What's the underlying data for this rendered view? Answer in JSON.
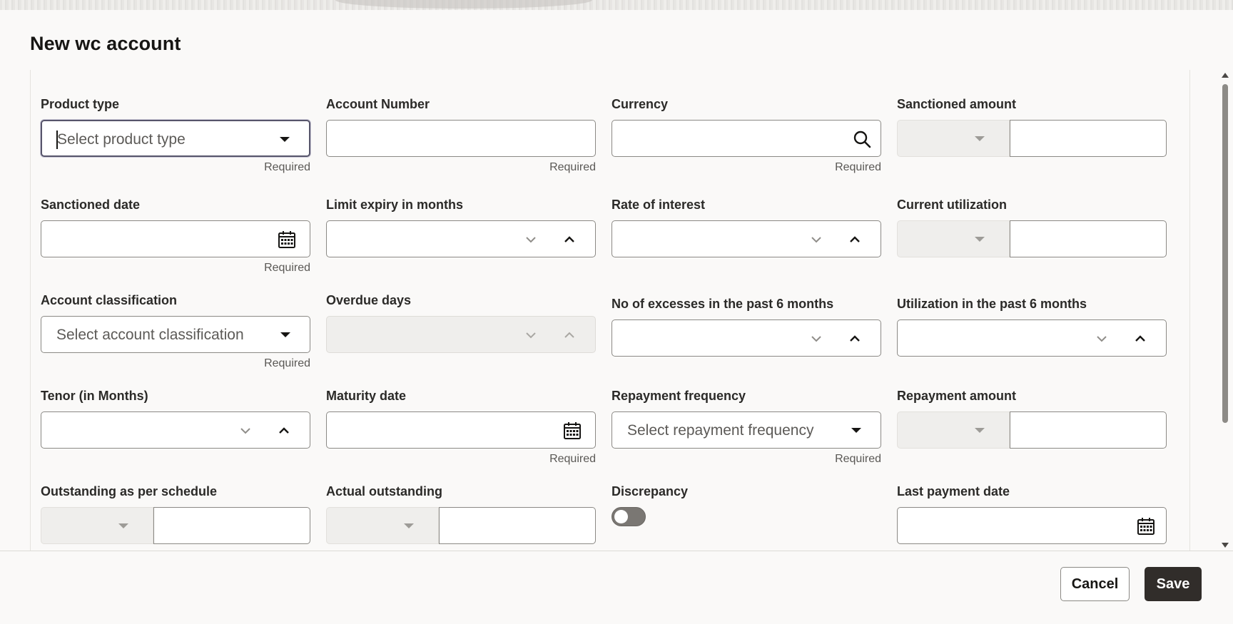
{
  "dialog": {
    "title": "New wc account"
  },
  "form": {
    "product_type": {
      "label": "Product type",
      "placeholder": "Select product type",
      "required": "Required"
    },
    "account_number": {
      "label": "Account Number",
      "value": "",
      "required": "Required"
    },
    "currency": {
      "label": "Currency",
      "value": "",
      "required": "Required",
      "icon": "search-icon"
    },
    "sanctioned_amount": {
      "label": "Sanctioned amount",
      "currency": "",
      "value": ""
    },
    "sanctioned_date": {
      "label": "Sanctioned date",
      "value": "",
      "required": "Required",
      "icon": "calendar-icon"
    },
    "limit_expiry": {
      "label": "Limit expiry in months",
      "value": ""
    },
    "rate_of_interest": {
      "label": "Rate of interest",
      "value": ""
    },
    "current_utilization": {
      "label": "Current utilization",
      "currency": "",
      "value": ""
    },
    "account_classification": {
      "label": "Account classification",
      "placeholder": "Select account classification",
      "required": "Required"
    },
    "overdue_days": {
      "label": "Overdue days",
      "value": ""
    },
    "excesses_6m": {
      "label": "No of excesses in the past 6 months",
      "value": ""
    },
    "utilization_6m": {
      "label": "Utilization in the past 6 months",
      "value": ""
    },
    "tenor": {
      "label": "Tenor (in Months)",
      "value": ""
    },
    "maturity_date": {
      "label": "Maturity date",
      "value": "",
      "required": "Required",
      "icon": "calendar-icon"
    },
    "repayment_frequency": {
      "label": "Repayment frequency",
      "placeholder": "Select repayment frequency",
      "required": "Required"
    },
    "repayment_amount": {
      "label": "Repayment amount",
      "currency": "",
      "value": ""
    },
    "outstanding_schedule": {
      "label": "Outstanding as per schedule",
      "currency": "",
      "value": ""
    },
    "actual_outstanding": {
      "label": "Actual outstanding",
      "currency": "",
      "value": ""
    },
    "discrepancy": {
      "label": "Discrepancy",
      "on": false
    },
    "last_payment_date": {
      "label": "Last payment date",
      "value": "",
      "icon": "calendar-icon"
    }
  },
  "footer": {
    "cancel_label": "Cancel",
    "save_label": "Save"
  }
}
